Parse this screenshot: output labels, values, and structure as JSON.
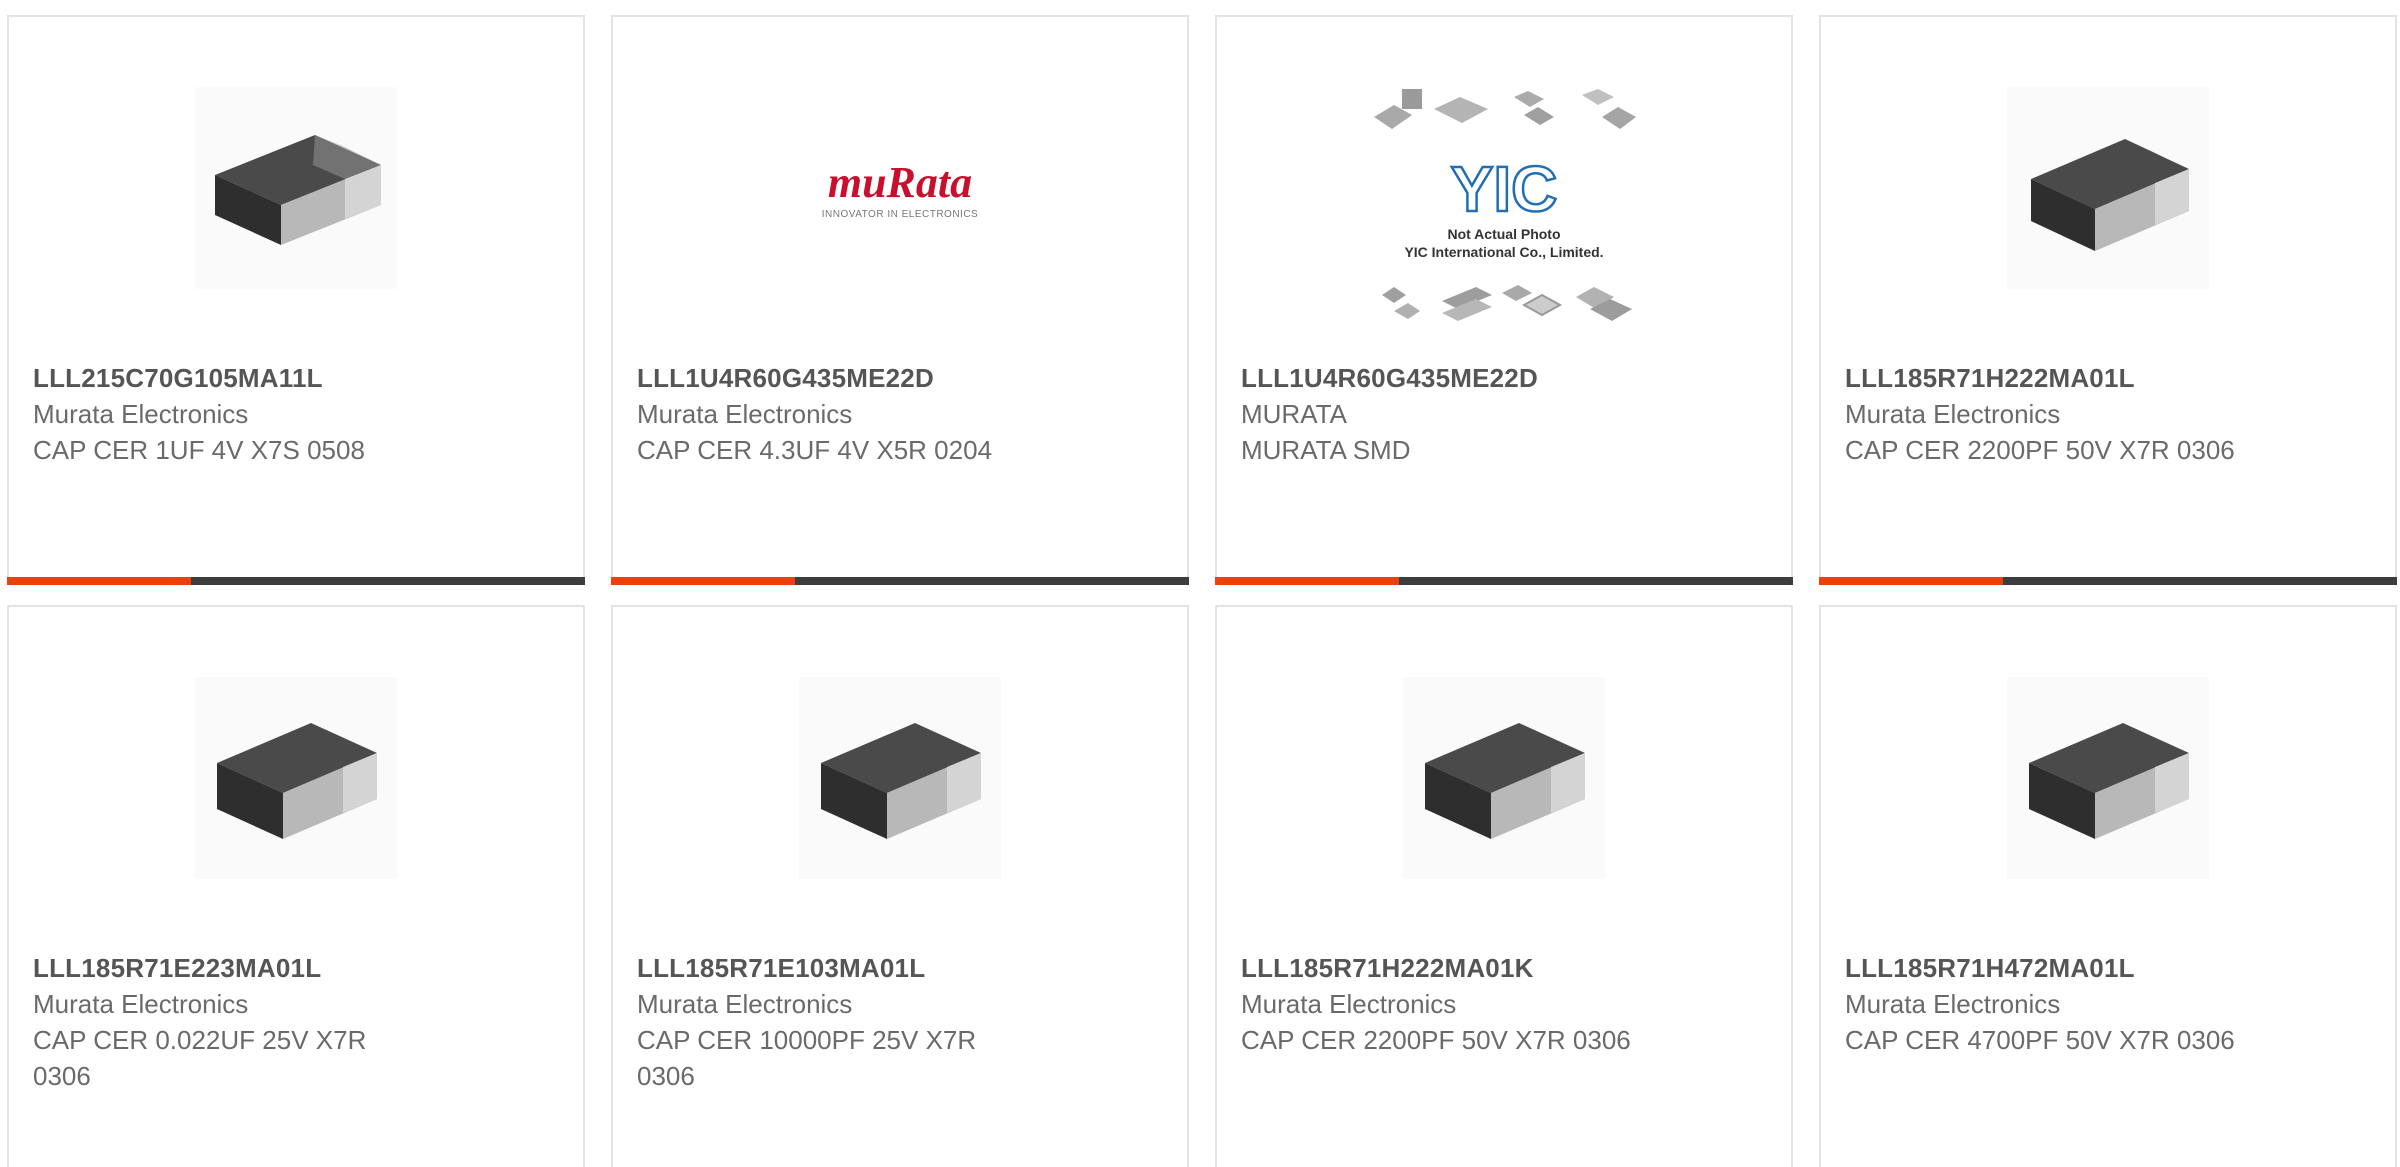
{
  "colors": {
    "accent": "#e8420f",
    "bar": "#3d3d3d",
    "border": "#e3e3e3",
    "text_bold": "#555555",
    "text": "#6a6a6a",
    "murata_red": "#c8102e",
    "yic_blue": "#1f6fb6"
  },
  "cards": [
    {
      "part_number": "LLL215C70G105MA11L",
      "manufacturer": "Murata Electronics",
      "description": "CAP CER 1UF 4V X7S 0508",
      "image_icon": "chip-capacitor-icon"
    },
    {
      "part_number": "LLL1U4R60G435ME22D",
      "manufacturer": "Murata Electronics",
      "description": "CAP CER 4.3UF 4V X5R 0204",
      "image_icon": "murata-logo",
      "logo_text": "muRata",
      "logo_tagline": "INNOVATOR IN ELECTRONICS"
    },
    {
      "part_number": "LLL1U4R60G435ME22D",
      "manufacturer": "MURATA",
      "description": "MURATA SMD",
      "image_icon": "yic-placeholder-image",
      "logo_text": "YIC",
      "placeholder_line1": "Not Actual Photo",
      "placeholder_line2": "YIC International Co., Limited."
    },
    {
      "part_number": "LLL185R71H222MA01L",
      "manufacturer": "Murata Electronics",
      "description": "CAP CER 2200PF 50V X7R 0306",
      "image_icon": "chip-capacitor-icon"
    },
    {
      "part_number": "LLL185R71E223MA01L",
      "manufacturer": "Murata Electronics",
      "description": "CAP CER 0.022UF 25V X7R 0306",
      "image_icon": "chip-capacitor-icon"
    },
    {
      "part_number": "LLL185R71E103MA01L",
      "manufacturer": "Murata Electronics",
      "description": "CAP CER 10000PF 25V X7R 0306",
      "image_icon": "chip-capacitor-icon"
    },
    {
      "part_number": "LLL185R71H222MA01K",
      "manufacturer": "Murata Electronics",
      "description": "CAP CER 2200PF 50V X7R 0306",
      "image_icon": "chip-capacitor-icon"
    },
    {
      "part_number": "LLL185R71H472MA01L",
      "manufacturer": "Murata Electronics",
      "description": "CAP CER 4700PF 50V X7R 0306",
      "image_icon": "chip-capacitor-icon"
    }
  ]
}
